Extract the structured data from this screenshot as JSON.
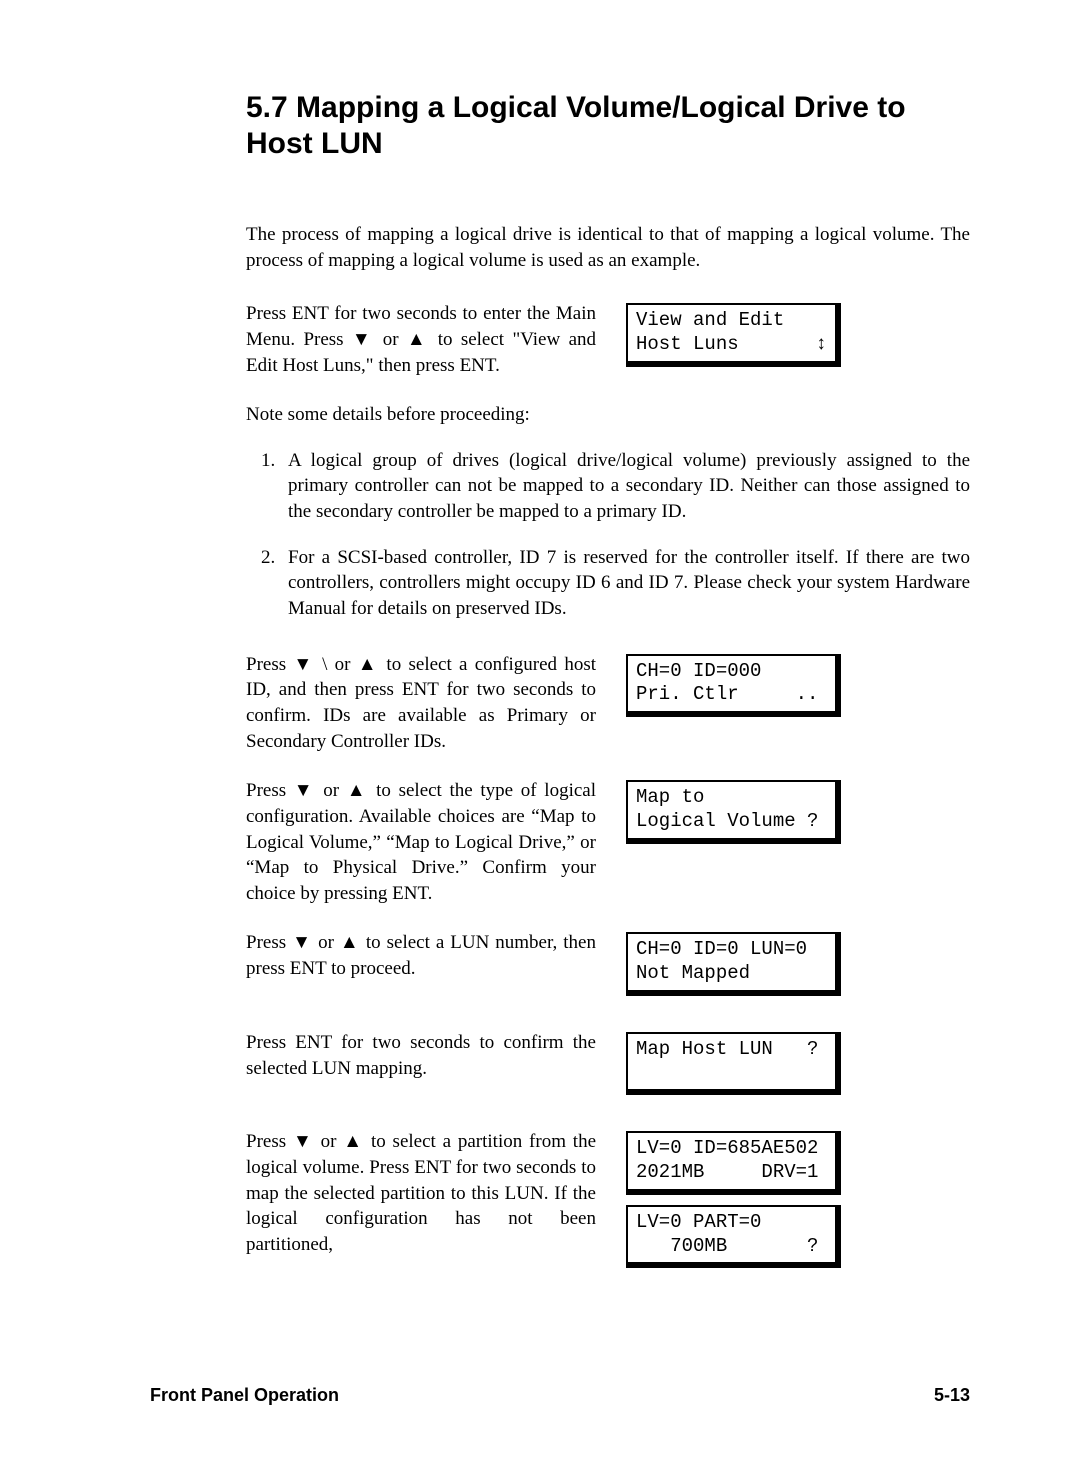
{
  "heading": "5.7 Mapping a Logical Volume/Logical Drive to Host LUN",
  "intro": "The process of mapping a logical drive is identical to that of mapping a logical volume.  The process of mapping a logical volume is used as an example.",
  "step1_text_a": "Press ENT for two seconds to enter the Main Menu.  Press ",
  "step1_text_b": " or ",
  "step1_text_c": " to select \"View and Edit Host Luns,\" then press ENT.",
  "note_intro": "Note some details before proceeding:",
  "notes": [
    "A logical group of drives (logical drive/logical volume) previously assigned to the primary controller can not be mapped to a secondary ID.  Neither can those assigned to the secondary controller be mapped to a primary ID.",
    "For a SCSI-based controller, ID 7 is reserved for the controller itself.  If there are two controllers, controllers might occupy ID 6 and ID 7.  Please check your system Hardware Manual for details on preserved IDs."
  ],
  "step2_a": "Press ",
  "step2_b": " \\ or ",
  "step2_c": " to select a configured host ID, and then press ENT for two seconds to confirm.  IDs are available as Primary or Secondary Controller IDs.",
  "step3_a": "Press ",
  "step3_b": " or ",
  "step3_c": " to select the type of logical configuration.  Available choices are “Map to Logical Volume,” “Map to Logical Drive,” or “Map to Physical Drive.”  Confirm your choice by pressing ENT.",
  "step4_a": "Press ",
  "step4_b": " or ",
  "step4_c": " to select a LUN number, then press ENT to proceed.",
  "step5": "Press ENT for two seconds to confirm the selected LUN mapping.",
  "step6_a": "Press ",
  "step6_b": " or ",
  "step6_c": " to select a partition from the logical volume.  Press ENT for two seconds to map the selected partition to this LUN.  If the logical configuration has not been partitioned,",
  "lcd1_l1": "View and Edit",
  "lcd1_l2": "Host Luns",
  "lcd1_sym": "↕",
  "lcd2_l1": "CH=0 ID=000",
  "lcd2_l2": "Pri. Ctlr     ..",
  "lcd3_l1": "Map to",
  "lcd3_l2": "Logical Volume ?",
  "lcd4_l1": "CH=0 ID=0 LUN=0",
  "lcd4_l2": "Not Mapped",
  "lcd5_l1": "Map Host LUN   ?",
  "lcd5_l2": " ",
  "lcd6_l1": "LV=0 ID=685AE502",
  "lcd6_l2": "2021MB     DRV=1",
  "lcd7_l1": "LV=0 PART=0",
  "lcd7_l2": "   700MB       ?",
  "footer_left": "Front Panel Operation",
  "footer_right": "5-13"
}
